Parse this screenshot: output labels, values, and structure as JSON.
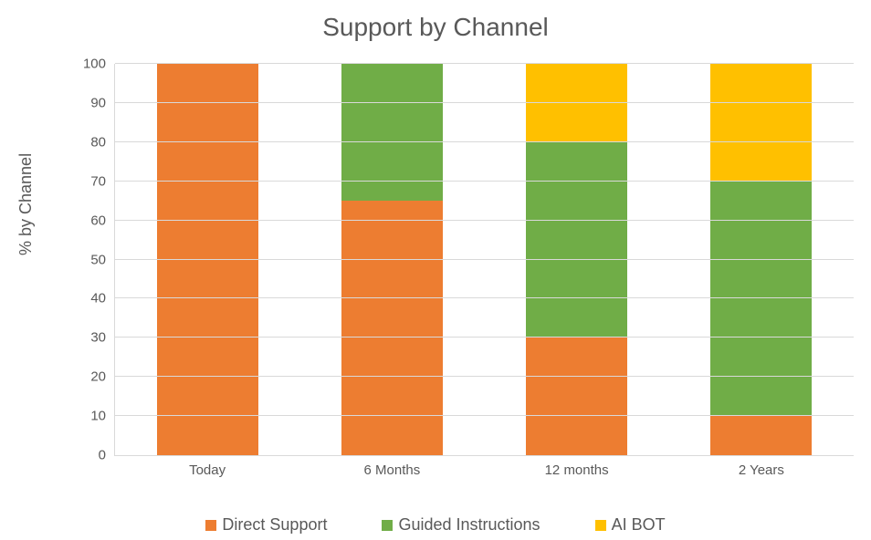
{
  "chart_data": {
    "type": "bar",
    "title": "Support by Channel",
    "xlabel": "",
    "ylabel": "% by Channel",
    "ylim": [
      0,
      100
    ],
    "y_ticks": [
      0,
      10,
      20,
      30,
      40,
      50,
      60,
      70,
      80,
      90,
      100
    ],
    "categories": [
      "Today",
      "6 Months",
      "12 months",
      "2 Years"
    ],
    "series": [
      {
        "name": "Direct Support",
        "color": "#ED7D31",
        "values": [
          100,
          65,
          30,
          10
        ]
      },
      {
        "name": "Guided Instructions",
        "color": "#70AD47",
        "values": [
          0,
          35,
          50,
          60
        ]
      },
      {
        "name": "AI BOT",
        "color": "#FFC000",
        "values": [
          0,
          0,
          20,
          30
        ]
      }
    ],
    "stacked": true,
    "legend_position": "bottom"
  }
}
